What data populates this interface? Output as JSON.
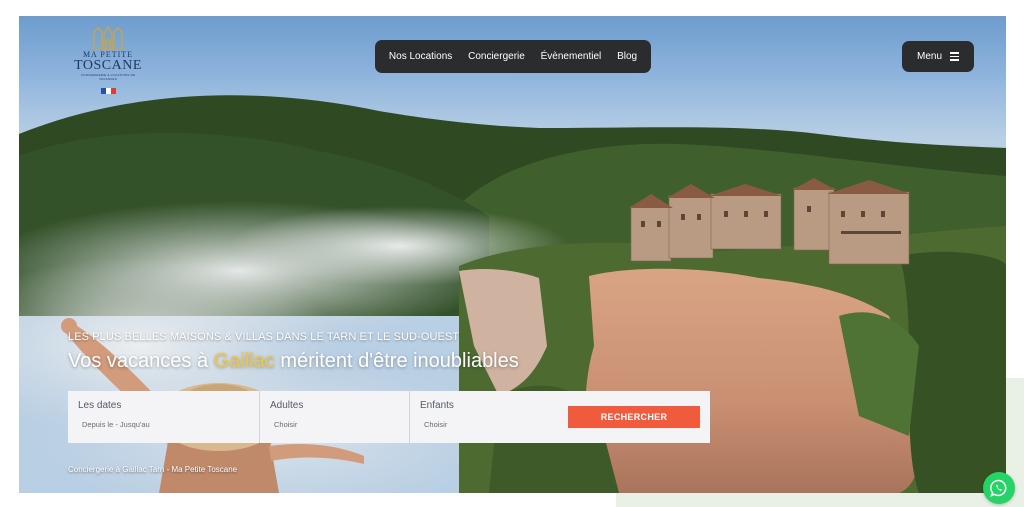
{
  "logo": {
    "line1": "MA PETITE",
    "line2": "TOSCANE",
    "tagline": "CONCIERGERIE & LOCATIONS DE VACANCES"
  },
  "nav": {
    "items": [
      "Nos Locations",
      "Conciergerie",
      "Évènementiel",
      "Blog"
    ]
  },
  "menu": {
    "label": "Menu"
  },
  "hero": {
    "kicker": "LES PLUS BELLES MAISONS & VILLAS DANS LE TARN ET LE SUD-OUEST",
    "headline_pre": "Vos vacances à ",
    "headline_highlight": "Gaillac",
    "headline_post": " méritent d'être inoubliables"
  },
  "search": {
    "dates_label": "Les dates",
    "dates_value": "Depuis le - Jusqu'au",
    "adults_label": "Adultes",
    "adults_value": "Choisir",
    "children_label": "Enfants",
    "children_value": "Choisir",
    "button_label": "RECHERCHER"
  },
  "footnote": "Conciergerie à Gaillac Tarn - Ma Petite Toscane",
  "colors": {
    "nav_bg": "#2b2c2e",
    "accent_orange": "#ef5b3c",
    "highlight_yellow": "#f2c53d",
    "whatsapp_green": "#25d366"
  },
  "icons": [
    "castle-logo-icon",
    "french-flag-icon",
    "hamburger-icon",
    "whatsapp-icon"
  ]
}
